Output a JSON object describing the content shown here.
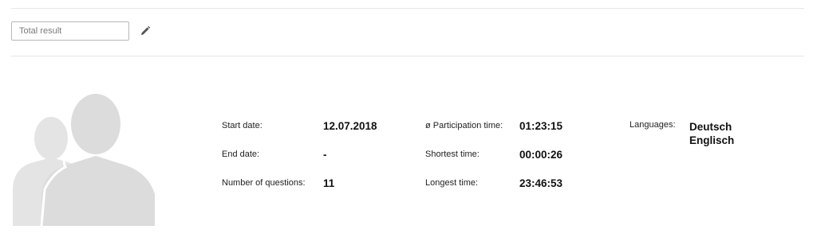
{
  "result_field": {
    "placeholder": "Total result"
  },
  "icons": {
    "edit": "pencil-icon",
    "avatar": "user-group-silhouette"
  },
  "stats": {
    "start_date": {
      "label": "Start date:",
      "value": "12.07.2018"
    },
    "end_date": {
      "label": "End date:",
      "value": "-"
    },
    "num_questions": {
      "label": "Number of questions:",
      "value": "11"
    },
    "participation_time": {
      "label": "ø Participation time:",
      "value": "01:23:15"
    },
    "shortest_time": {
      "label": "Shortest time:",
      "value": "00:00:26"
    },
    "longest_time": {
      "label": "Longest time:",
      "value": "23:46:53"
    },
    "languages": {
      "label": "Languages:",
      "values": [
        "Deutsch",
        "Englisch"
      ]
    }
  },
  "colors": {
    "divider": "#e6e6e6",
    "avatar": "#dedede",
    "text": "#222222"
  }
}
